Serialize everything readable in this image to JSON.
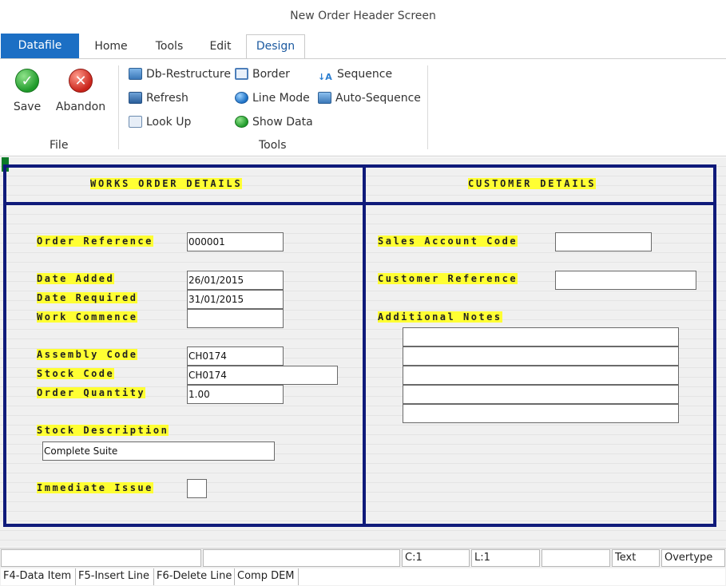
{
  "window": {
    "title": "New Order Header Screen"
  },
  "tabs": [
    {
      "label": "Datafile"
    },
    {
      "label": "Home"
    },
    {
      "label": "Tools"
    },
    {
      "label": "Edit"
    },
    {
      "label": "Design"
    }
  ],
  "ribbon": {
    "file_group": {
      "label": "File",
      "save_label": "Save",
      "abandon_label": "Abandon"
    },
    "tools_group": {
      "label": "Tools",
      "db_restructure": "Db-Restructure",
      "refresh": "Refresh",
      "look_up": "Look Up",
      "border": "Border",
      "line_mode": "Line Mode",
      "show_data": "Show Data",
      "sequence": "Sequence",
      "auto_sequence": "Auto-Sequence"
    }
  },
  "icons": {
    "save": "check-circle-icon",
    "abandon": "x-circle-icon",
    "db_restructure": "database-icon",
    "refresh": "refresh-icon",
    "look_up": "lookup-icon",
    "border": "border-icon",
    "line_mode": "line-mode-icon",
    "show_data": "show-data-icon",
    "sequence": "sort-az-icon",
    "auto_sequence": "auto-sequence-icon"
  },
  "colors": {
    "accent": "#1c6fc4",
    "frame": "#0f1a7a",
    "label_highlight": "#ffff33"
  },
  "works_order": {
    "heading": "WORKS ORDER DETAILS",
    "order_reference_label": "Order Reference",
    "order_reference_value": "000001",
    "date_added_label": "Date Added",
    "date_added_value": "26/01/2015",
    "date_required_label": "Date Required",
    "date_required_value": "31/01/2015",
    "work_commence_label": "Work Commence",
    "work_commence_value": "",
    "assembly_code_label": "Assembly Code",
    "assembly_code_value": "CH0174",
    "stock_code_label": "Stock Code",
    "stock_code_value": "CH0174",
    "order_quantity_label": "Order Quantity",
    "order_quantity_value": "1.00",
    "stock_description_label": "Stock Description",
    "stock_description_value": "Complete Suite",
    "immediate_issue_label": "Immediate Issue",
    "immediate_issue_value": ""
  },
  "customer": {
    "heading": "CUSTOMER DETAILS",
    "sales_account_code_label": "Sales Account Code",
    "sales_account_code_value": "",
    "customer_reference_label": "Customer Reference",
    "customer_reference_value": "",
    "additional_notes_label": "Additional Notes",
    "additional_notes_lines": [
      "",
      "",
      "",
      "",
      ""
    ]
  },
  "status": {
    "cells": [
      "",
      "",
      "C:1",
      "L:1",
      "",
      "Text",
      "Overtype"
    ],
    "function_keys": [
      "F4-Data Item",
      "F5-Insert Line",
      "F6-Delete Line",
      "Comp DEM",
      ""
    ]
  }
}
